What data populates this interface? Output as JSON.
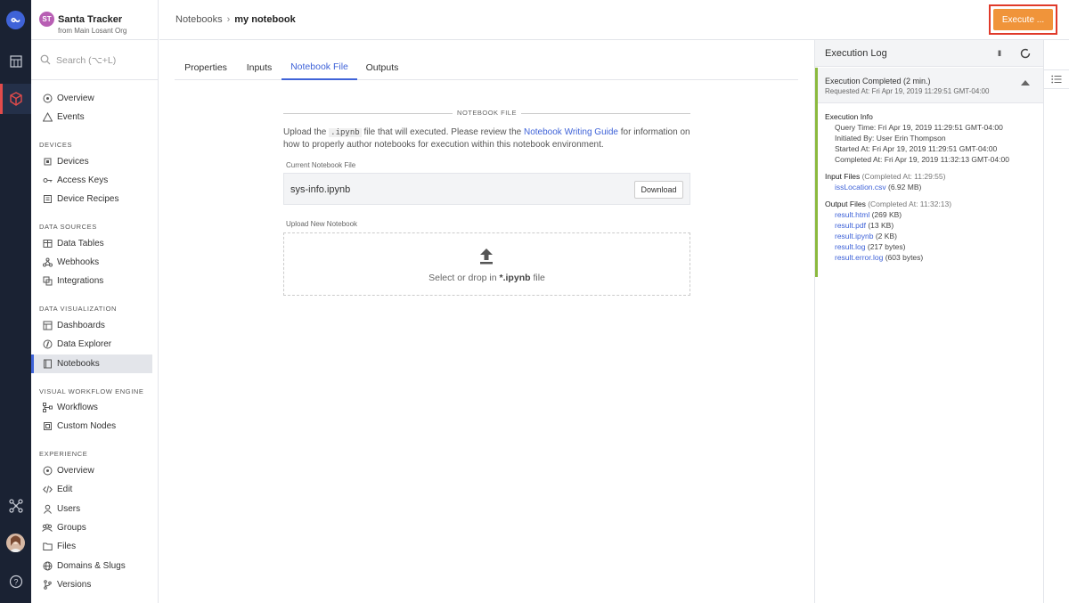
{
  "rail": {
    "logo": "losant-logo-icon",
    "items": [
      "dashboard-icon",
      "cube-icon",
      "network-icon",
      "avatar",
      "help-icon"
    ]
  },
  "app": {
    "initials": "ST",
    "name": "Santa Tracker",
    "org": "from Main Losant Org"
  },
  "search": {
    "placeholder": "Search (⌥+L)"
  },
  "nav": {
    "overview": "Overview",
    "events": "Events",
    "devices_section": "DEVICES",
    "devices": "Devices",
    "access_keys": "Access Keys",
    "device_recipes": "Device Recipes",
    "data_sources_section": "DATA SOURCES",
    "data_tables": "Data Tables",
    "webhooks": "Webhooks",
    "integrations": "Integrations",
    "data_viz_section": "DATA VISUALIZATION",
    "dashboards": "Dashboards",
    "data_explorer": "Data Explorer",
    "notebooks": "Notebooks",
    "vwe_section": "VISUAL WORKFLOW ENGINE",
    "workflows": "Workflows",
    "custom_nodes": "Custom Nodes",
    "experience_section": "EXPERIENCE",
    "exp_overview": "Overview",
    "edit": "Edit",
    "users": "Users",
    "groups": "Groups",
    "files": "Files",
    "domains": "Domains & Slugs",
    "versions": "Versions"
  },
  "header": {
    "crumb_parent": "Notebooks",
    "crumb_sep": "›",
    "crumb_current": "my notebook",
    "execute_label": "Execute ..."
  },
  "tabs": [
    "Properties",
    "Inputs",
    "Notebook File",
    "Outputs"
  ],
  "content": {
    "section_label": "NOTEBOOK FILE",
    "desc_1": "Upload the ",
    "desc_code": ".ipynb",
    "desc_2": " file that will executed. Please review the ",
    "desc_link": "Notebook Writing Guide",
    "desc_3": " for information on how to properly author notebooks for execution within this notebook environment.",
    "current_label": "Current Notebook File",
    "current_file": "sys-info.ipynb",
    "download_label": "Download",
    "upload_label": "Upload New Notebook",
    "drop_text_1": "Select or drop in ",
    "drop_text_bold": "*.ipynb",
    "drop_text_2": " file"
  },
  "log": {
    "title": "Execution Log",
    "pause": "II",
    "status": "Execution Completed (2 min.)",
    "requested": "Requested At: Fri Apr 19, 2019 11:29:51 GMT-04:00",
    "info_title": "Execution Info",
    "query_time": "Query Time: Fri Apr 19, 2019 11:29:51 GMT-04:00",
    "initiated_by": "Initiated By: User Erin Thompson",
    "started_at": "Started At: Fri Apr 19, 2019 11:29:51 GMT-04:00",
    "completed_at": "Completed At: Fri Apr 19, 2019 11:32:13 GMT-04:00",
    "input_title": "Input Files",
    "input_completed": "(Completed At: 11:29:55)",
    "input_file": "issLocation.csv",
    "input_size": "(6.92 MB)",
    "output_title": "Output Files",
    "output_completed": "(Completed At: 11:32:13)",
    "outputs": [
      {
        "name": "result.html",
        "size": "(269 KB)"
      },
      {
        "name": "result.pdf",
        "size": "(13 KB)"
      },
      {
        "name": "result.ipynb",
        "size": "(2 KB)"
      },
      {
        "name": "result.log",
        "size": "(217 bytes)"
      },
      {
        "name": "result.error.log",
        "size": "(603 bytes)"
      }
    ]
  },
  "colors": {
    "accent": "#3f63d8",
    "execute": "#f0943a",
    "highlight": "#e03a2a",
    "success": "#8bb93e",
    "rail": "#1a2233"
  }
}
